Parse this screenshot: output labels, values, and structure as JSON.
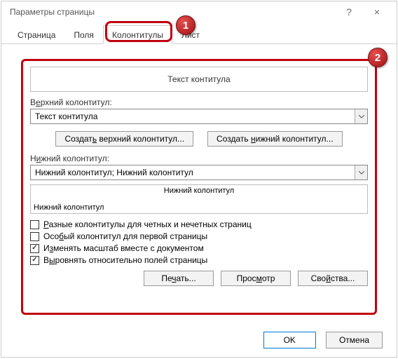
{
  "window": {
    "title": "Параметры страницы",
    "help_icon": "?",
    "close_icon": "×"
  },
  "badges": {
    "one": "1",
    "two": "2"
  },
  "tabs": {
    "page": "Страница",
    "margins": "Поля",
    "headers": "Колонтитулы",
    "sheet": "Лист"
  },
  "content": {
    "top_preview": "Текст контитула",
    "header_label": "Верхний колонтитул:",
    "header_value": "Текст контитула",
    "create_header_btn": "Создать верхний колонтитул...",
    "create_footer_btn": "Создать нижний колонтитул...",
    "footer_label": "Нижний колонтитул:",
    "footer_value": "Нижний колонтитул; Нижний колонтитул",
    "bottom_preview_title": "Нижний колонтитул",
    "bottom_preview_text": "Нижний колонтитул",
    "check1": "Разные колонтитулы для четных и нечетных страниц",
    "check2": "Особый колонтитул для первой страницы",
    "check3": "Изменять масштаб вместе с документом",
    "check4": "Выровнять относительно полей страницы",
    "print_btn": "Печать...",
    "preview_btn": "Просмотр",
    "props_btn": "Свойства..."
  },
  "footer": {
    "ok": "OK",
    "cancel": "Отмена"
  }
}
